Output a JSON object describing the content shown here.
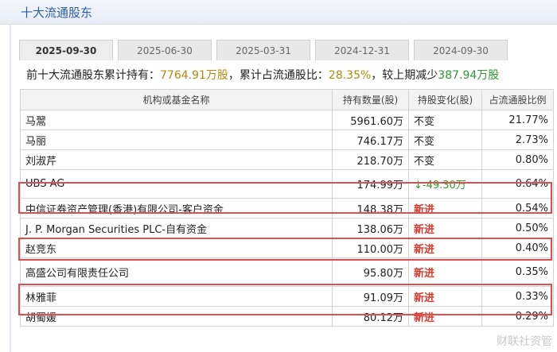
{
  "header": {
    "title": "十大流通股东"
  },
  "tabs": [
    {
      "label": "2025-09-30",
      "active": true
    },
    {
      "label": "2025-06-30",
      "active": false
    },
    {
      "label": "2025-03-31",
      "active": false
    },
    {
      "label": "2024-12-31",
      "active": false
    },
    {
      "label": "2024-09-30",
      "active": false
    }
  ],
  "summary": {
    "prefix": "前十大流通股东累计持有：",
    "total": "7764.91万股",
    "mid": "，累计占流通股比：",
    "ratio": "28.35%",
    "mid2": "，较上期减少",
    "change": "387.94万股"
  },
  "table": {
    "columns": [
      "机构或基金名称",
      "持有数量(股)",
      "持股变化(股)",
      "占流通股比例"
    ],
    "rows": [
      {
        "name": "马翯",
        "qty": "5961.60万",
        "change": "不变",
        "ratio": "21.77%"
      },
      {
        "name": "马丽",
        "qty": "746.17万",
        "change": "不变",
        "ratio": "2.73%"
      },
      {
        "name": "刘淑芹",
        "qty": "218.70万",
        "change": "不变",
        "ratio": "0.80%"
      },
      {
        "name": "UBS AG",
        "qty": "174.99万",
        "change": "↓-49.30万",
        "ratio": "0.64%"
      },
      {
        "name": "中信证券资产管理(香港)有限公司-客户资金",
        "qty": "148.38万",
        "change": "新进",
        "ratio": "0.54%"
      },
      {
        "name": "J. P. Morgan Securities PLC-自有资金",
        "qty": "138.06万",
        "change": "新进",
        "ratio": "0.50%"
      },
      {
        "name": "赵竞东",
        "qty": "110.00万",
        "change": "新进",
        "ratio": "0.40%"
      },
      {
        "name": "高盛公司有限责任公司",
        "qty": "95.80万",
        "change": "新进",
        "ratio": "0.35%"
      },
      {
        "name": "林雅菲",
        "qty": "91.09万",
        "change": "新进",
        "ratio": "0.33%"
      },
      {
        "name": "胡蜀媛",
        "qty": "80.12万",
        "change": "新进",
        "ratio": "0.29%"
      }
    ]
  },
  "watermark": "财联社资管",
  "colors": {
    "highlight_box": "#e04f4f",
    "new_entry": "#d63a2f",
    "decrease": "#2e9a2e",
    "title": "#2f5fa7"
  }
}
